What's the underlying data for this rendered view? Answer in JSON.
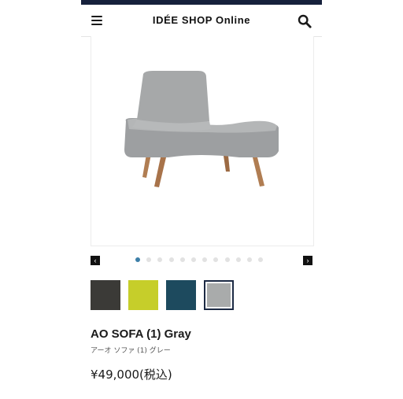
{
  "header": {
    "logo": "IDÉE SHOP Online",
    "menu_icon": "hamburger-menu-icon",
    "search_icon": "search-icon",
    "topbar_color": "#16213c"
  },
  "gallery": {
    "image_alt": "grey upholstered sofa chair with wooden legs",
    "prev_arrow": "‹",
    "next_arrow": "›",
    "slide_count": 12,
    "active_slide": 1,
    "active_dot_color": "#3d7fa8"
  },
  "swatches": [
    {
      "name": "charcoal",
      "color": "#3b3a37",
      "selected": false
    },
    {
      "name": "lime",
      "color": "#c6ce2a",
      "selected": false
    },
    {
      "name": "teal-navy",
      "color": "#1d4a5e",
      "selected": false
    },
    {
      "name": "gray",
      "color": "#a9abab",
      "selected": true
    }
  ],
  "product": {
    "name": "AO SOFA (1) Gray",
    "name_ja": "アーオ ソファ (1) グレー",
    "price": "¥49,000(税込)"
  }
}
